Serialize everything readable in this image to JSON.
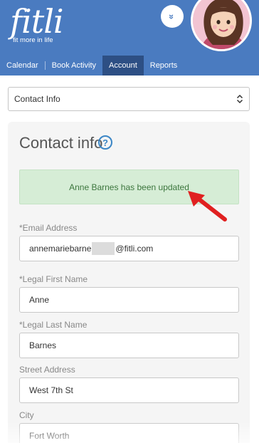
{
  "brand": {
    "logo_text": "fitli",
    "tagline": "fit more in life",
    "color": "#4a7bc0",
    "nav_active_color": "#2d4f84"
  },
  "header": {
    "expand_icon": "chevron-double-down-icon"
  },
  "nav": {
    "items": [
      {
        "label": "Calendar"
      },
      {
        "label": "Book Activity"
      },
      {
        "label": "Account",
        "active": true
      },
      {
        "label": "Reports"
      }
    ]
  },
  "section_select": {
    "value": "Contact Info"
  },
  "contact_card": {
    "title": "Contact info",
    "help_icon": "question-circle-icon",
    "alert": {
      "message": "Anne Barnes has been updated",
      "color": "#3c763d",
      "background": "#d6edd6"
    },
    "fields": {
      "email": {
        "label": "*Email Address",
        "value_prefix": "annemariebarne",
        "value_suffix": "@fitli.com"
      },
      "first_name": {
        "label": "*Legal First Name",
        "value": "Anne"
      },
      "last_name": {
        "label": "*Legal Last Name",
        "value": "Barnes"
      },
      "street": {
        "label": "Street Address",
        "value": "West 7th St"
      },
      "city": {
        "label": "City",
        "value": "Fort Worth"
      }
    }
  },
  "annotation": {
    "arrow_color": "#e02020"
  }
}
